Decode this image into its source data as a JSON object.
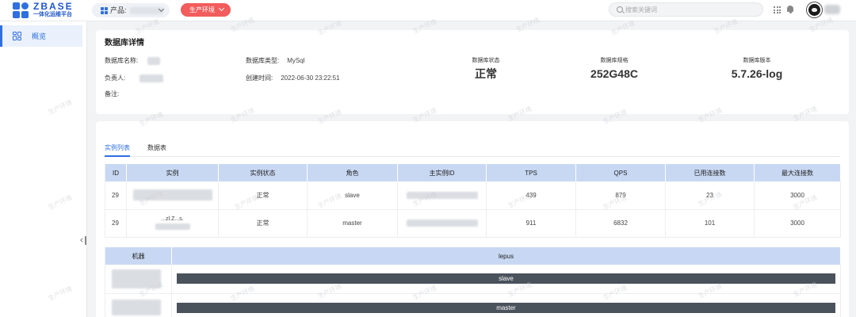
{
  "header": {
    "logo_title": "ZBASE",
    "logo_subtitle": "一体化运维平台",
    "product_label": "产品:",
    "env_label": "生产环境",
    "search_placeholder": "搜索关键词"
  },
  "sidebar": {
    "items": [
      {
        "label": "概览"
      }
    ]
  },
  "detail": {
    "title": "数据库详情",
    "fields": {
      "db_name_label": "数据库名称:",
      "db_type_label": "数据库类型:",
      "db_type_value": "MySql",
      "owner_label": "负责人:",
      "created_label": "创建时间:",
      "created_value": "2022-06-30 23:22:51",
      "note_label": "备注:"
    },
    "stats": [
      {
        "label": "数据库状态",
        "value": "正常"
      },
      {
        "label": "数据库规格",
        "value": "252G48C"
      },
      {
        "label": "数据库版本",
        "value": "5.7.26-log"
      }
    ]
  },
  "tabs": [
    {
      "label": "实例列表",
      "active": true
    },
    {
      "label": "数据表",
      "active": false
    }
  ],
  "instance_table": {
    "headers": [
      "ID",
      "实例",
      "实例状态",
      "角色",
      "主实例ID",
      "TPS",
      "QPS",
      "已用连接数",
      "最大连接数"
    ],
    "rows": [
      {
        "id": "29",
        "instance": "",
        "status": "正常",
        "role": "slave",
        "master_id": "",
        "tps": "439",
        "qps": "879",
        "used_conn": "23",
        "max_conn": "3000"
      },
      {
        "id": "29",
        "instance": "...zl.Z...s.",
        "status": "正常",
        "role": "master",
        "master_id": "",
        "tps": "911",
        "qps": "6832",
        "used_conn": "101",
        "max_conn": "3000"
      }
    ]
  },
  "machine_table": {
    "headers": [
      "机器",
      "lepus"
    ],
    "rows": [
      {
        "machine": "",
        "role": "slave"
      },
      {
        "machine": "",
        "role": "master"
      }
    ]
  },
  "watermark_text": "生产环境",
  "colors": {
    "accent": "#2f6fe0",
    "env_badge": "#f25c5c",
    "table_header": "#c8d8f3",
    "role_bar": "#4a525c"
  }
}
